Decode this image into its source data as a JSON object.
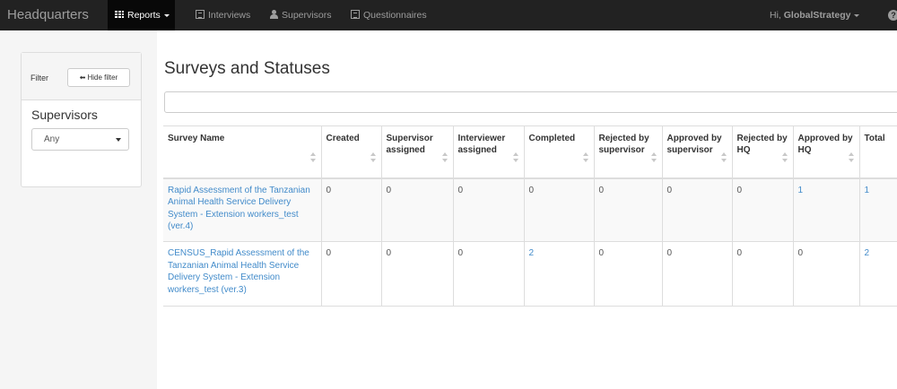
{
  "navbar": {
    "brand": "Headquarters",
    "items": [
      {
        "label": "Reports",
        "icon": "grid-icon",
        "active": true
      },
      {
        "label": "Interviews",
        "icon": "list-icon"
      },
      {
        "label": "Supervisors",
        "icon": "user-icon"
      },
      {
        "label": "Questionnaires",
        "icon": "list-icon"
      }
    ],
    "greeting_prefix": "Hi,",
    "username": "GlobalStrategy",
    "help_icon": "question-circle-icon"
  },
  "filter": {
    "label": "Filter",
    "hide_button": "Hide filter",
    "supervisors_title": "Supervisors",
    "supervisors_selected": "Any"
  },
  "main": {
    "title": "Surveys and Statuses",
    "search_placeholder": ""
  },
  "table": {
    "columns": [
      "Survey Name",
      "Created",
      "Supervisor assigned",
      "Interviewer assigned",
      "Completed",
      "Rejected by supervisor",
      "Approved by supervisor",
      "Rejected by HQ",
      "Approved by HQ",
      "Total"
    ],
    "rows": [
      {
        "name": "Rapid Assessment of the Tanzanian Animal Health Service Delivery System - Extension workers_test (ver.4)",
        "cells": [
          "0",
          "0",
          "0",
          "0",
          "0",
          "0",
          "0",
          "1",
          "1"
        ],
        "links": [
          false,
          false,
          false,
          false,
          false,
          false,
          false,
          true,
          true
        ]
      },
      {
        "name": "CENSUS_Rapid Assessment of the Tanzanian Animal Health Service Delivery System - Extension workers_test (ver.3)",
        "cells": [
          "0",
          "0",
          "0",
          "2",
          "0",
          "0",
          "0",
          "0",
          "2"
        ],
        "links": [
          false,
          false,
          false,
          true,
          false,
          false,
          false,
          false,
          true
        ]
      }
    ]
  },
  "colors": {
    "navbar_bg": "#222222",
    "link": "#428bca",
    "sidebar_bg": "#f5f5f5"
  }
}
